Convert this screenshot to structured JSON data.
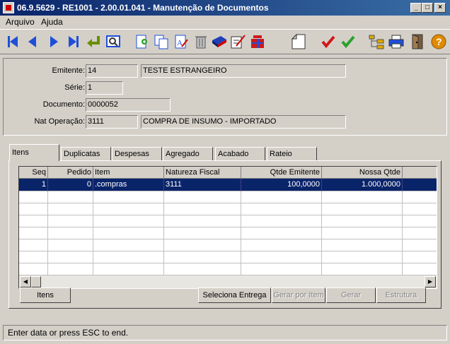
{
  "window": {
    "title": "06.9.5629 - RE1001 - 2.00.01.041 - Manutenção de Documentos"
  },
  "menu": [
    {
      "label": "Arquivo"
    },
    {
      "label": "Ajuda"
    }
  ],
  "toolbar": {
    "icons": [
      "first-icon",
      "prev-icon",
      "next-icon",
      "last-icon",
      "goto-icon",
      "search-icon",
      "new-icon",
      "copy-icon",
      "edit-icon",
      "delete-icon",
      "books-icon",
      "signature-icon",
      "gift-icon",
      "blank-page-icon",
      "cancel-check-icon",
      "confirm-check-icon",
      "tree-icon",
      "print-icon",
      "exit-icon",
      "help-icon"
    ]
  },
  "form": {
    "emitente_label": "Emitente:",
    "emitente_code": "14",
    "emitente_name": "TESTE ESTRANGEIRO",
    "serie_label": "Série:",
    "serie_value": "1",
    "documento_label": "Documento:",
    "documento_value": "0000052",
    "natop_label": "Nat Operação:",
    "natop_code": "3111",
    "natop_desc": "COMPRA DE INSUMO - IMPORTADO"
  },
  "tabs": [
    {
      "label": "Itens"
    },
    {
      "label": "Duplicatas"
    },
    {
      "label": "Despesas"
    },
    {
      "label": "Agregado"
    },
    {
      "label": "Acabado"
    },
    {
      "label": "Rateio"
    }
  ],
  "grid": {
    "columns": [
      "Seq",
      "Pedido",
      "Item",
      "Natureza Fiscal",
      "Qtde Emitente",
      "Nossa Qtde"
    ],
    "rows": [
      {
        "seq": "1",
        "pedido": "0",
        "item": ".compras",
        "natureza": "3111",
        "qtde_emitente": "100,0000",
        "nossa_qtde": "1.000,0000"
      }
    ]
  },
  "buttons": {
    "itens": "Itens",
    "seleciona_entrega": "Seleciona Entrega",
    "gerar_por_item": "Gerar por Item",
    "gerar": "Gerar",
    "estrutura": "Estrutura"
  },
  "status": {
    "text": "Enter data or press ESC to end."
  }
}
